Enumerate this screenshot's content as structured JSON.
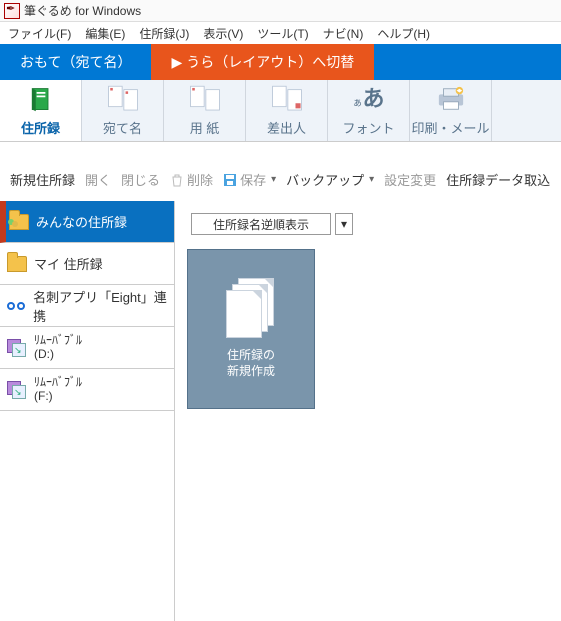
{
  "title": "筆ぐるめ for Windows",
  "menus": [
    "ファイル(F)",
    "編集(E)",
    "住所録(J)",
    "表示(V)",
    "ツール(T)",
    "ナビ(N)",
    "ヘルプ(H)"
  ],
  "main_tabs": {
    "front": "おもて（宛て名）",
    "back": "うら（レイアウト）へ切替"
  },
  "ribbon": {
    "addressbook": "住所録",
    "atenai": "宛て名",
    "paper": "用 紙",
    "sender": "差出人",
    "font": "フォント",
    "print": "印刷・メール"
  },
  "toolbar": {
    "new": "新規住所録",
    "open": "開く",
    "close": "閉じる",
    "delete": "削除",
    "save": "保存",
    "backup": "バックアップ",
    "settings": "設定変更",
    "import": "住所録データ取込"
  },
  "sidebar": {
    "everyone": "みんなの住所録",
    "mine": "マイ 住所録",
    "eight": "名刺アプリ「Eight」連携",
    "removD_l1": "ﾘﾑｰﾊﾞﾌﾞﾙ",
    "removD_l2": "(D:)",
    "removF_l1": "ﾘﾑｰﾊﾞﾌﾞﾙ",
    "removF_l2": "(F:)"
  },
  "sort_label": "住所録名逆順表示",
  "tile": {
    "line1": "住所録の",
    "line2": "新規作成"
  }
}
